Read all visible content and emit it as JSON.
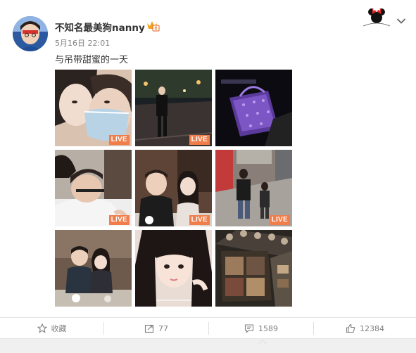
{
  "post": {
    "username": "不知名最美狗nanny",
    "timestamp": "5月16日 22:01",
    "text": "与吊带甜蜜的一天",
    "live_label": "LIVE",
    "photos": [
      {
        "desc": "selfie-with-mask",
        "live": true
      },
      {
        "desc": "street-night",
        "live": true
      },
      {
        "desc": "purple-bag",
        "live": false
      },
      {
        "desc": "haircut",
        "live": true
      },
      {
        "desc": "restaurant-duo",
        "live": true
      },
      {
        "desc": "mall-walk",
        "live": true
      },
      {
        "desc": "kids-table",
        "live": false
      },
      {
        "desc": "girl-selfie",
        "live": false
      },
      {
        "desc": "eyeshadow-palette",
        "live": false
      }
    ]
  },
  "actions": {
    "favorite_label": "收藏",
    "repost_count": "77",
    "comment_count": "1589",
    "like_count": "12384"
  },
  "icons": {
    "favorite": "star-icon",
    "repost": "repost-icon",
    "comment": "comment-icon",
    "like": "thumbs-up-icon",
    "menu": "chevron-down-icon"
  },
  "colors": {
    "live_badge": "#f07d4a",
    "text_primary": "#333333",
    "text_secondary": "#808080"
  }
}
